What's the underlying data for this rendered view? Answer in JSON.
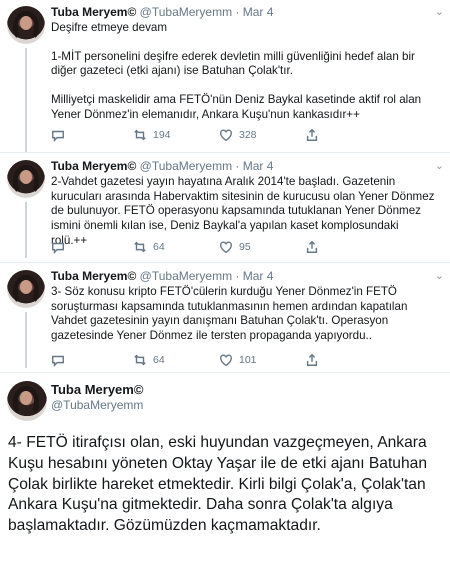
{
  "tweets": [
    {
      "name": "Tuba Meryem©",
      "handle": "@TubaMeryemm",
      "date": "Mar 4",
      "lines": [
        "Deşifre etmeye devam",
        "",
        "1-MİT personelini deşifre ederek devletin milli güvenliğini hedef alan bir diğer gazeteci (etki ajanı) ise Batuhan Çolak'tır.",
        "",
        "Milliyetçi maskelidir ama FETÖ'nün Deniz Baykal kasetinde aktif rol alan Yener Dönmez'in elemanıdır, Ankara Kuşu'nun kankasıdır++"
      ],
      "retweets": "194",
      "likes": "328"
    },
    {
      "name": "Tuba Meryem©",
      "handle": "@TubaMeryemm",
      "date": "Mar 4",
      "lines": [
        "2-Vahdet gazetesi yayın hayatına Aralık 2014'te başladı. Gazetenin kurucuları arasında Habervaktim sitesinin de kurucusu olan Yener Dönmez de bulunuyor. FETÖ operasyonu kapsamında tutuklanan Yener Dönmez ismini önemli kılan ise, Deniz Baykal'a yapılan kaset komplosundaki rolü.++"
      ],
      "retweets": "64",
      "likes": "95"
    },
    {
      "name": "Tuba Meryem©",
      "handle": "@TubaMeryemm",
      "date": "Mar 4",
      "lines": [
        "3- Söz konusu kripto FETÖ'cülerin kurduğu Yener Dönmez'in FETÖ soruşturması kapsamında tutuklanmasının hemen ardından kapatılan Vahdet gazetesinin yayın danışmanı Batuhan Çolak'tı. Operasyon gazetesinde Yener Dönmez ile tersten propaganda yapıyordu.."
      ],
      "retweets": "64",
      "likes": "101"
    }
  ],
  "main_tweet": {
    "name": "Tuba Meryem©",
    "handle": "@TubaMeryemm",
    "text": "4- FETÖ itirafçısı olan, eski huyundan vazgeçmeyen, Ankara Kuşu hesabını yöneten Oktay Yaşar ile de etki ajanı Batuhan Çolak birlikte hareket etmektedir. Kirli bilgi Çolak'a, Çolak'tan Ankara Kuşu'na gitmektedir. Daha sonra Çolak'ta algıya başlamaktadır. Gözümüzden kaçmamaktadır."
  },
  "icons": [
    "reply-icon",
    "retweet-icon",
    "like-icon",
    "share-icon",
    "caret-down-icon"
  ]
}
